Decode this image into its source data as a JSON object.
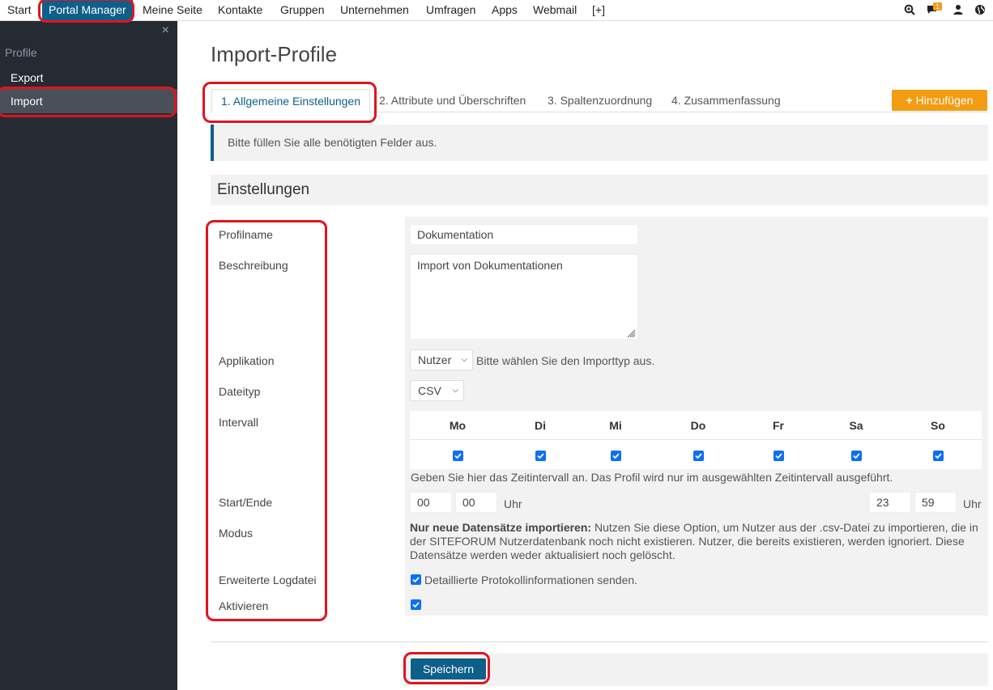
{
  "nav": {
    "items": [
      "Start",
      "Portal Manager",
      "Meine Seite",
      "Kontakte",
      "Gruppen",
      "Unternehmen",
      "Umfragen",
      "Apps",
      "Webmail",
      "[+]"
    ],
    "notification_count": "1",
    "icons": [
      "search-icon",
      "chat-icon",
      "user-icon",
      "globe-icon"
    ]
  },
  "sidebar": {
    "close": "×",
    "heading": "Profile",
    "links": [
      "Export",
      "Import"
    ]
  },
  "page": {
    "title": "Import-Profile",
    "tabs": [
      "1. Allgemeine Einstellungen",
      "2. Attribute und Überschriften",
      "3. Spaltenzuordnung",
      "4. Zusammenfassung"
    ],
    "add_button": "Hinzufügen",
    "alert": "Bitte füllen Sie alle benötigten Felder aus.",
    "section_title": "Einstellungen"
  },
  "form": {
    "labels": {
      "profile_name": "Profilname",
      "description": "Beschreibung",
      "application": "Applikation",
      "file_type": "Dateityp",
      "interval": "Intervall",
      "start_end": "Start/Ende",
      "mode": "Modus",
      "extended_log": "Erweiterte Logdatei",
      "activate": "Aktivieren"
    },
    "profile_name_value": "Dokumentation",
    "description_value": "Import von Dokumentationen",
    "application_value": "Nutzer",
    "application_hint": "Bitte wählen Sie den Importtyp aus.",
    "file_type_value": "CSV",
    "days": [
      "Mo",
      "Di",
      "Mi",
      "Do",
      "Fr",
      "Sa",
      "So"
    ],
    "days_checked": [
      true,
      true,
      true,
      true,
      true,
      true,
      true
    ],
    "interval_hint": "Geben Sie hier das Zeitintervall an. Das Profil wird nur im ausgewählten Zeitintervall ausgeführt.",
    "start_hour": "00",
    "start_minute": "00",
    "end_hour": "23",
    "end_minute": "59",
    "uhr": "Uhr",
    "mode_bold": "Nur neue Datensätze importieren:",
    "mode_text": " Nutzen Sie diese Option, um Nutzer aus der .csv-Datei zu importieren, die in der SITEFORUM Nutzerdatenbank noch nicht existieren. Nutzer, die bereits existieren, werden ignoriert. Diese Datensätze werden weder aktualisiert noch gelöscht.",
    "extended_log_label": "Detaillierte Protokollinformationen senden.",
    "extended_log_checked": true,
    "activate_checked": true
  },
  "save_button": "Speichern",
  "colors": {
    "primary": "#0e5f8a",
    "accent": "#f39c12",
    "sidebar": "#262b33",
    "annotation": "#e0141e"
  }
}
